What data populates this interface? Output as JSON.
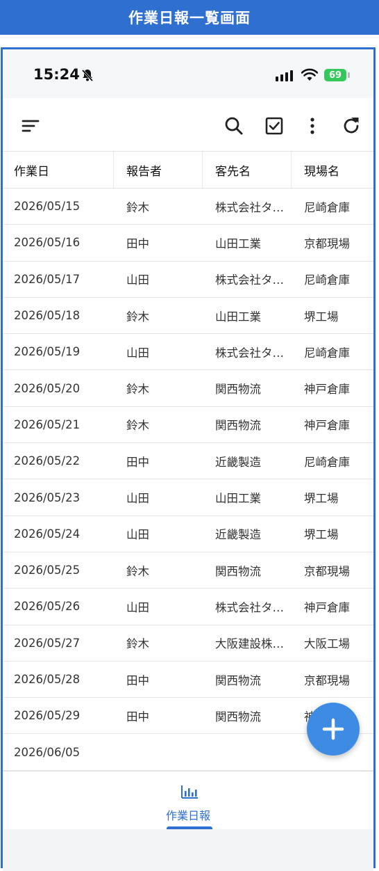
{
  "window_title": "作業日報一覧画面",
  "status_bar": {
    "time": "15:24",
    "battery": "69"
  },
  "app_bar_icons": [
    "menu-sort-icon",
    "search-icon",
    "checkbox-icon",
    "more-vert-icon",
    "refresh-icon"
  ],
  "table": {
    "headers": [
      "作業日",
      "報告者",
      "客先名",
      "現場名"
    ],
    "rows": [
      [
        "2026/05/15",
        "鈴木",
        "株式会社タ…",
        "尼崎倉庫"
      ],
      [
        "2026/05/16",
        "田中",
        "山田工業",
        "京都現場"
      ],
      [
        "2026/05/17",
        "山田",
        "株式会社タ…",
        "尼崎倉庫"
      ],
      [
        "2026/05/18",
        "鈴木",
        "山田工業",
        "堺工場"
      ],
      [
        "2026/05/19",
        "山田",
        "株式会社タ…",
        "尼崎倉庫"
      ],
      [
        "2026/05/20",
        "鈴木",
        "関西物流",
        "神戸倉庫"
      ],
      [
        "2026/05/21",
        "鈴木",
        "関西物流",
        "神戸倉庫"
      ],
      [
        "2026/05/22",
        "田中",
        "近畿製造",
        "尼崎倉庫"
      ],
      [
        "2026/05/23",
        "山田",
        "山田工業",
        "堺工場"
      ],
      [
        "2026/05/24",
        "山田",
        "近畿製造",
        "堺工場"
      ],
      [
        "2026/05/25",
        "鈴木",
        "関西物流",
        "京都現場"
      ],
      [
        "2026/05/26",
        "山田",
        "株式会社タ…",
        "神戸倉庫"
      ],
      [
        "2026/05/27",
        "鈴木",
        "大阪建設株…",
        "大阪工場"
      ],
      [
        "2026/05/28",
        "田中",
        "関西物流",
        "京都現場"
      ],
      [
        "2026/05/29",
        "田中",
        "関西物流",
        "神戸倉庫"
      ],
      [
        "2026/06/05",
        "",
        "",
        ""
      ]
    ]
  },
  "fab": {
    "icon": "plus-icon"
  },
  "bottom_nav": {
    "label": "作業日報",
    "icon": "bar-chart-icon",
    "accent": "#2f6fd0"
  },
  "colors": {
    "title_bar": "#2f6fd0",
    "fab": "#3e8be3",
    "battery": "#34c759"
  }
}
